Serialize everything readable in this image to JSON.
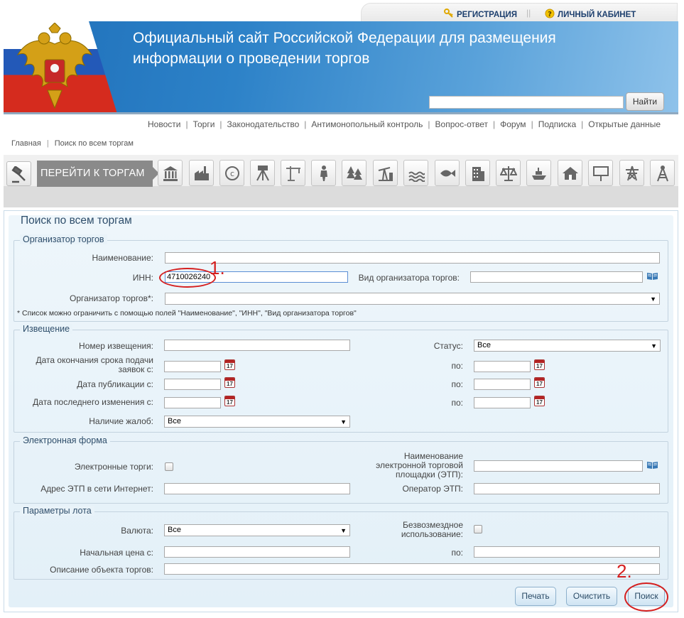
{
  "toplinks": {
    "register": "РЕГИСТРАЦИЯ",
    "cabinet": "ЛИЧНЫЙ КАБИНЕТ",
    "separator": "||"
  },
  "header": {
    "title_line1": "Официальный сайт Российской Федерации для размещения",
    "title_line2": "информации о проведении торгов",
    "search_button": "Найти",
    "search_value": ""
  },
  "nav": {
    "items": [
      "Новости",
      "Торги",
      "Законодательство",
      "Антимонопольный контроль",
      "Вопрос-ответ",
      "Форум",
      "Подписка",
      "Открытые данные"
    ],
    "separator": "|"
  },
  "breadcrumb": {
    "home": "Главная",
    "current": "Поиск по всем торгам",
    "separator": "|"
  },
  "categories": {
    "go_button": "ПЕРЕЙТИ К ТОРГАМ",
    "icons": [
      "bank-icon",
      "factory-icon",
      "copyright-icon",
      "theodolite-icon",
      "crane-icon",
      "hunter-icon",
      "forest-icon",
      "oil-pump-icon",
      "water-icon",
      "fish-icon",
      "building-icon",
      "scales-icon",
      "ship-icon",
      "house-icon",
      "billboard-icon",
      "power-line-icon",
      "radio-tower-icon"
    ]
  },
  "form": {
    "title": "Поиск по всем торгам",
    "organizer": {
      "legend": "Организатор торгов",
      "name_label": "Наименование:",
      "name_value": "",
      "inn_label": "ИНН:",
      "inn_value": "4710026240",
      "type_label": "Вид организатора торгов:",
      "type_value": "",
      "organizer_label": "Организатор торгов*:",
      "organizer_value": "",
      "note": "* Список можно ограничить с помощью полей \"Наименование\", \"ИНН\", \"Вид организатора торгов\""
    },
    "notice": {
      "legend": "Извещение",
      "number_label": "Номер извещения:",
      "number_value": "",
      "status_label": "Статус:",
      "status_value": "Все",
      "deadline_label": "Дата окончания срока подачи заявок с:",
      "published_label": "Дата публикации с:",
      "modified_label": "Дата последнего изменения с:",
      "to_label": "по:",
      "complaints_label": "Наличие жалоб:",
      "complaints_value": "Все",
      "calendar_day": "17"
    },
    "electronic": {
      "legend": "Электронная форма",
      "etrade_label": "Электронные торги:",
      "etp_name_label": "Наименование электронной торговой площадки (ЭТП):",
      "etp_address_label": "Адрес ЭТП в сети Интернет:",
      "etp_operator_label": "Оператор ЭТП:"
    },
    "lot": {
      "legend": "Параметры лота",
      "currency_label": "Валюта:",
      "currency_value": "Все",
      "free_use_label": "Безвозмездное использование:",
      "price_from_label": "Начальная цена с:",
      "price_to_label": "по:",
      "description_label": "Описание объекта торгов:"
    },
    "buttons": {
      "print": "Печать",
      "clear": "Очистить",
      "search": "Поиск"
    }
  },
  "annotations": {
    "first": "1.",
    "second": "2."
  },
  "colors": {
    "annotation": "#d51f1f",
    "banner": "#2d82c8",
    "panel": "#e9f3f9"
  }
}
